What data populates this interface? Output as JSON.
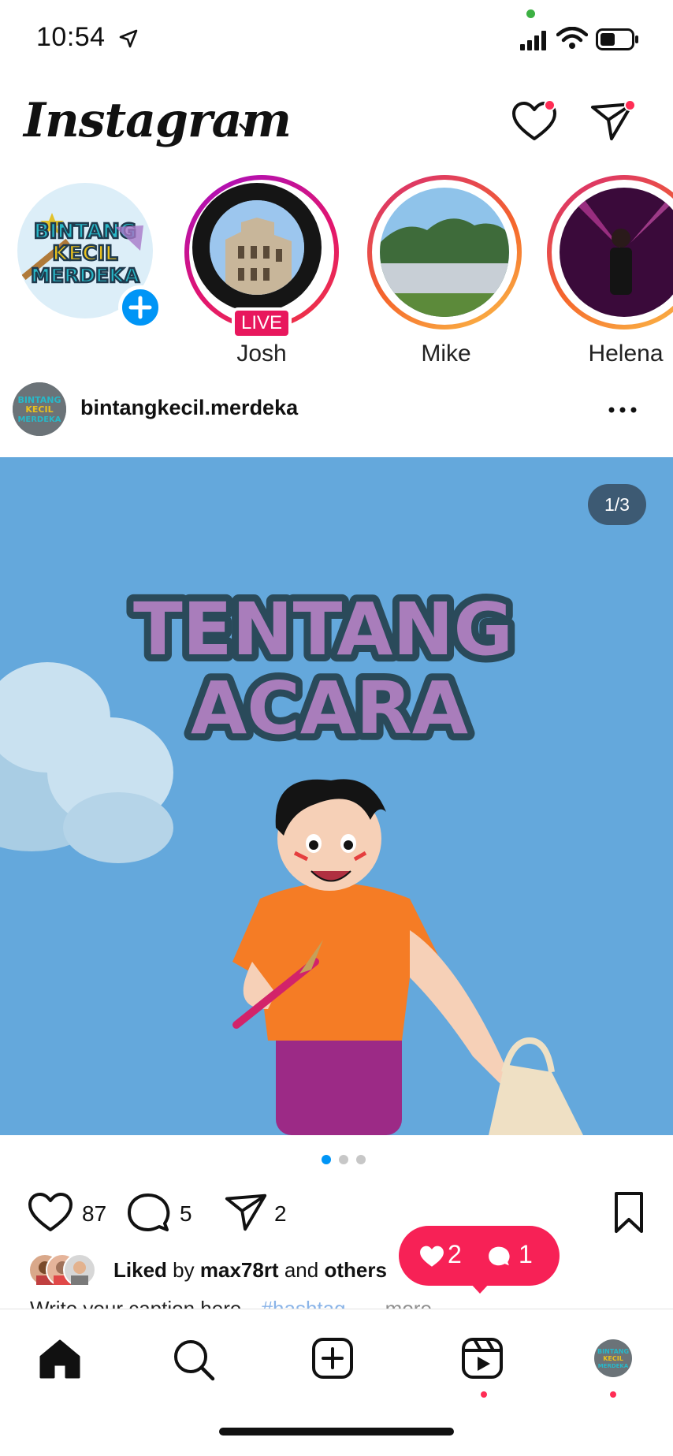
{
  "status_bar": {
    "time": "10:54"
  },
  "header": {
    "app_name": "Instagram"
  },
  "stories": [
    {
      "name": "",
      "type": "own"
    },
    {
      "name": "Josh",
      "badge": "LIVE"
    },
    {
      "name": "Mike"
    },
    {
      "name": "Helena"
    }
  ],
  "own_story_logo": [
    "BINTANG",
    "KECIL",
    "MERDEKA"
  ],
  "post": {
    "username": "bintangkecil.merdeka",
    "counter": "1/3",
    "image_title_line1": "TENTANG",
    "image_title_line2": "ACARA",
    "likes": "87",
    "comments": "5",
    "shares": "2",
    "liked_by_prefix": "Liked",
    "liked_by_mid": "by",
    "liked_by_user": "max78rt",
    "liked_by_and": "and",
    "liked_by_others": "others",
    "caption_text": "Write your caption here",
    "caption_hashtag": "#hashtag",
    "caption_more": "... more"
  },
  "activity_popup": {
    "likes": "2",
    "comments": "1"
  },
  "colors": {
    "live": "#e8175d",
    "accent_blue": "#0095f6",
    "notification": "#f72156",
    "post_bg": "#64a8dc"
  }
}
